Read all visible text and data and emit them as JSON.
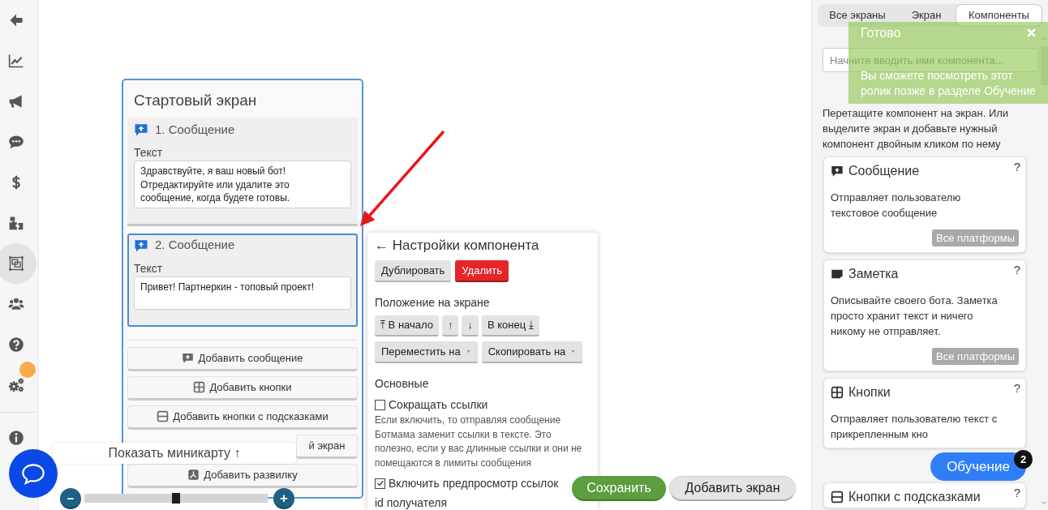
{
  "sidebar": {
    "items": [
      {
        "selected": false,
        "notification": false
      },
      {
        "selected": false,
        "notification": false
      },
      {
        "selected": false,
        "notification": false
      },
      {
        "selected": false,
        "notification": false
      },
      {
        "selected": false,
        "notification": false
      },
      {
        "selected": false,
        "notification": false
      },
      {
        "selected": true,
        "notification": false
      },
      {
        "selected": false,
        "notification": false
      },
      {
        "selected": false,
        "notification": false
      },
      {
        "selected": false,
        "notification": true
      }
    ],
    "footer_items": [
      {
        "selected": false,
        "notification": false
      }
    ]
  },
  "canvas": {
    "screen": {
      "title": "Стартовый экран",
      "components": [
        {
          "title": "1. Сообщение",
          "field_label": "Текст",
          "text": "Здравствуйте, я ваш новый бот! Отредактируйте или удалите это сообщение, когда будете готовы.",
          "selected": false
        },
        {
          "title": "2. Сообщение",
          "field_label": "Текст",
          "text": "Привет! Партнеркин - топовый проект!",
          "selected": true
        }
      ],
      "add_buttons": [
        {
          "kind": "message",
          "label": "Добавить сообщение"
        },
        {
          "kind": "buttons",
          "label": "Добавить кнопки"
        },
        {
          "kind": "hint_buttons",
          "label": "Добавить кнопки с подсказками"
        },
        {
          "kind": "partial",
          "label": "й экран"
        },
        {
          "kind": "fork",
          "label": "Добавить развилку"
        }
      ]
    }
  },
  "settings_panel": {
    "title": "← Настройки компонента",
    "actions": [
      {
        "kind": "neutral",
        "label": "Дублировать"
      },
      {
        "kind": "danger",
        "label": "Удалить"
      }
    ],
    "position_title": "Положение на экране",
    "position_buttons": [
      {
        "label": "⤒ В начало"
      },
      {
        "label": "↑"
      },
      {
        "label": "↓"
      },
      {
        "label": "В конец ⤓"
      }
    ],
    "transfer_buttons": [
      {
        "label": "Переместить на"
      },
      {
        "label": "Скопировать на"
      }
    ],
    "section_title": "Основные",
    "options": [
      {
        "label": "Сокращать ссылки",
        "checked": false,
        "description": "Если включить, то отправляя сообщение Ботмама заменит ссылки в тексте. Это полезно, если у вас длинные ссылки и они не помещаются в лимиты сообщения"
      },
      {
        "label": "Включить предпросмотр ссылок",
        "checked": true
      }
    ],
    "field_label": "id получателя"
  },
  "footer_buttons": [
    {
      "kind": "primary",
      "label": "Сохранить"
    },
    {
      "kind": "secondary",
      "label": "Добавить экран"
    }
  ],
  "minimap": {
    "label": "Показать миникарту ↑"
  },
  "zoom": {
    "minus": "−",
    "plus": "+",
    "level": 0.5
  },
  "right_panel": {
    "tabs": [
      {
        "label": "Все экраны",
        "selected": false
      },
      {
        "label": "Экран",
        "selected": false
      },
      {
        "label": "Компоненты",
        "selected": true
      }
    ],
    "search": {
      "placeholder": "Начните вводить имя компонента..."
    },
    "hint": "Перетащите компонент на экран. Или выделите экран и добавьте нужный компонент двойным кликом по нему",
    "components": [
      {
        "kind": "message",
        "title": "Сообщение",
        "help": "?",
        "description": "Отправляет пользователю текстовое сообщение",
        "platforms": "Все платформы"
      },
      {
        "kind": "note",
        "title": "Заметка",
        "help": "?",
        "description": "Описывайте своего бота. Заметка просто хранит текст и ничего никому не отправляет.",
        "platforms": "Все платформы"
      },
      {
        "kind": "buttons",
        "title": "Кнопки",
        "help": "?",
        "description": "Отправляет пользователю текст с прикрепленным кно"
      },
      {
        "kind": "hint_buttons",
        "title": "Кнопки с подсказками",
        "help": "?"
      }
    ]
  },
  "toast": {
    "title": "Готово",
    "message": "Вы сможете посмотреть этот ролик позже в разделе Обучение"
  },
  "tutorial_button": {
    "label": "Обучение",
    "badge": "2"
  }
}
